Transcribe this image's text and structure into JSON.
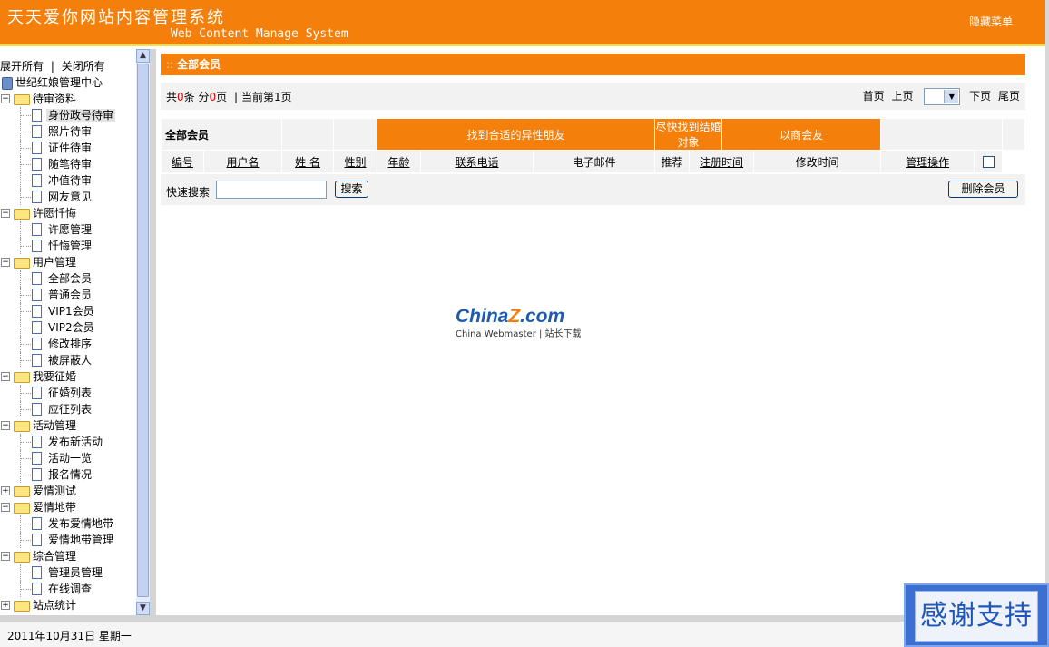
{
  "header": {
    "title": "天天爱你网站内容管理系统",
    "subtitle": "Web Content Manage System",
    "hide_menu": "隐藏菜单"
  },
  "sidebar": {
    "expand_all": "展开所有",
    "separator": "|",
    "collapse_all": "关闭所有",
    "root": "世纪红娘管理中心",
    "tree": [
      {
        "type": "folder",
        "label": "待审资料",
        "expanded": true
      },
      {
        "type": "leaf",
        "label": "身份政号待审",
        "selected": true
      },
      {
        "type": "leaf",
        "label": "照片待审"
      },
      {
        "type": "leaf",
        "label": "证件待审"
      },
      {
        "type": "leaf",
        "label": "随笔待审"
      },
      {
        "type": "leaf",
        "label": "冲值待审"
      },
      {
        "type": "leaf",
        "label": "网友意见"
      },
      {
        "type": "folder",
        "label": "许愿忏悔",
        "expanded": true
      },
      {
        "type": "leaf",
        "label": "许愿管理"
      },
      {
        "type": "leaf",
        "label": "忏悔管理"
      },
      {
        "type": "folder",
        "label": "用户管理",
        "expanded": true
      },
      {
        "type": "leaf",
        "label": "全部会员"
      },
      {
        "type": "leaf",
        "label": "普通会员"
      },
      {
        "type": "leaf",
        "label": "VIP1会员"
      },
      {
        "type": "leaf",
        "label": "VIP2会员"
      },
      {
        "type": "leaf",
        "label": "修改排序"
      },
      {
        "type": "leaf",
        "label": "被屏蔽人"
      },
      {
        "type": "folder",
        "label": "我要征婚",
        "expanded": true
      },
      {
        "type": "leaf",
        "label": "征婚列表"
      },
      {
        "type": "leaf",
        "label": "应征列表"
      },
      {
        "type": "folder",
        "label": "活动管理",
        "expanded": true
      },
      {
        "type": "leaf",
        "label": "发布新活动"
      },
      {
        "type": "leaf",
        "label": "活动一览"
      },
      {
        "type": "leaf",
        "label": "报名情况"
      },
      {
        "type": "folder",
        "label": "爱情测试",
        "expanded": false
      },
      {
        "type": "folder",
        "label": "爱情地带",
        "expanded": true
      },
      {
        "type": "leaf",
        "label": "发布爱情地带"
      },
      {
        "type": "leaf",
        "label": "爱情地带管理"
      },
      {
        "type": "folder",
        "label": "综合管理",
        "expanded": true
      },
      {
        "type": "leaf",
        "label": "管理员管理"
      },
      {
        "type": "leaf",
        "label": "在线调查"
      },
      {
        "type": "folder",
        "label": "站点统计",
        "expanded": false
      }
    ]
  },
  "main": {
    "panel_title_prefix": "::",
    "panel_title": "全部会员",
    "pager": {
      "total_prefix": "共",
      "total_count": "0",
      "total_unit": "条",
      "pages_prefix": "分",
      "pages_count": "0",
      "pages_unit": "页",
      "sep": "|",
      "current": "当前第1页",
      "first": "首页",
      "prev": "上页",
      "next": "下页",
      "last": "尾页"
    },
    "table": {
      "group_title": "全部会员",
      "tabs": [
        "找到合适的异性朋友",
        "尽快找到结婚对象",
        "以商会友"
      ],
      "columns": [
        "编号",
        "用户名",
        "姓 名",
        "性别",
        "年龄",
        "联系电话",
        "电子邮件",
        "推荐",
        "注册时间",
        "修改时间",
        "管理操作"
      ]
    },
    "search": {
      "label": "快速搜索",
      "value": "",
      "button": "搜索",
      "delete_button": "删除会员"
    },
    "watermark": {
      "logo_prefix": "China",
      "logo_z": "Z",
      "logo_suffix": ".com",
      "tagline": "China Webmaster | 站长下载"
    }
  },
  "status": {
    "date": "2011年10月31日  星期一"
  },
  "badge": {
    "text": "感谢支持"
  }
}
